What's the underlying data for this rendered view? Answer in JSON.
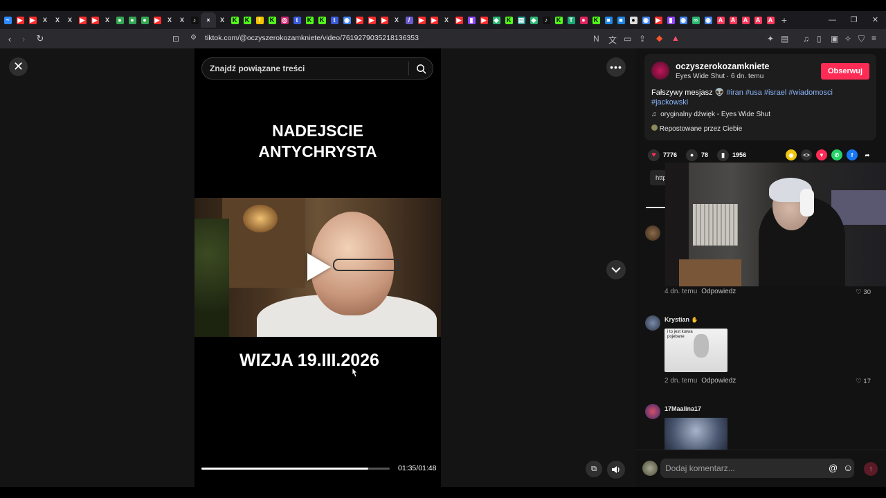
{
  "browser": {
    "tabs": [
      {
        "icon": "messenger-icon",
        "color": "#2e89ff",
        "glyph": "~"
      },
      {
        "icon": "youtube-icon",
        "color": "#ff2d2d",
        "glyph": "▶"
      },
      {
        "icon": "youtube-icon",
        "color": "#ff2d2d",
        "glyph": "▶"
      },
      {
        "icon": "x-icon",
        "color": "#2a2a2a",
        "glyph": "X"
      },
      {
        "icon": "x-icon",
        "color": "#2a2a2a",
        "glyph": "X"
      },
      {
        "icon": "x-icon",
        "color": "#2a2a2a",
        "glyph": "X"
      },
      {
        "icon": "youtube-icon",
        "color": "#ff2d2d",
        "glyph": "▶"
      },
      {
        "icon": "youtube-icon",
        "color": "#ff2d2d",
        "glyph": "▶"
      },
      {
        "icon": "x-icon",
        "color": "#2a2a2a",
        "glyph": "X"
      },
      {
        "icon": "maps-icon",
        "color": "#34a853",
        "glyph": "●"
      },
      {
        "icon": "maps-icon",
        "color": "#34a853",
        "glyph": "●"
      },
      {
        "icon": "maps-icon",
        "color": "#34a853",
        "glyph": "●"
      },
      {
        "icon": "youtube-icon",
        "color": "#ff2d2d",
        "glyph": "▶"
      },
      {
        "icon": "x-icon",
        "color": "#2a2a2a",
        "glyph": "X"
      },
      {
        "icon": "x-icon",
        "color": "#2a2a2a",
        "glyph": "X"
      },
      {
        "icon": "tiktok-icon",
        "color": "#111",
        "glyph": "♪"
      },
      {
        "icon": "close-tab-icon",
        "color": "#2d2d33",
        "glyph": "×"
      },
      {
        "icon": "x-icon",
        "color": "#2a2a2a",
        "glyph": "X"
      },
      {
        "icon": "kick-icon",
        "color": "#53fc18",
        "glyph": "K"
      },
      {
        "icon": "kick-icon",
        "color": "#53fc18",
        "glyph": "K"
      },
      {
        "icon": "yellow-icon",
        "color": "#f5c400",
        "glyph": "!"
      },
      {
        "icon": "kick-icon",
        "color": "#53fc18",
        "glyph": "K"
      },
      {
        "icon": "instagram-icon",
        "color": "#d62976",
        "glyph": "◎"
      },
      {
        "icon": "tip-icon",
        "color": "#3b5bdb",
        "glyph": "t"
      },
      {
        "icon": "kick-icon",
        "color": "#53fc18",
        "glyph": "K"
      },
      {
        "icon": "kick-icon",
        "color": "#53fc18",
        "glyph": "K"
      },
      {
        "icon": "tip-icon",
        "color": "#3b5bdb",
        "glyph": "t"
      },
      {
        "icon": "chrome-icon",
        "color": "#4285f4",
        "glyph": "◉"
      },
      {
        "icon": "youtube-icon",
        "color": "#ff2d2d",
        "glyph": "▶"
      },
      {
        "icon": "youtube-icon",
        "color": "#ff2d2d",
        "glyph": "▶"
      },
      {
        "icon": "youtube-icon",
        "color": "#ff2d2d",
        "glyph": "▶"
      },
      {
        "icon": "x-icon",
        "color": "#2a2a2a",
        "glyph": "X"
      },
      {
        "icon": "feather-icon",
        "color": "#6a5acd",
        "glyph": "/"
      },
      {
        "icon": "youtube-icon",
        "color": "#ff2d2d",
        "glyph": "▶"
      },
      {
        "icon": "youtube-icon",
        "color": "#ff2d2d",
        "glyph": "▶"
      },
      {
        "icon": "x-icon",
        "color": "#2a2a2a",
        "glyph": "X"
      },
      {
        "icon": "youtube-icon",
        "color": "#ff2d2d",
        "glyph": "▶"
      },
      {
        "icon": "twitch-icon",
        "color": "#9146ff",
        "glyph": "▮"
      },
      {
        "icon": "youtube-icon",
        "color": "#ff2d2d",
        "glyph": "▶"
      },
      {
        "icon": "green-icon",
        "color": "#2bb673",
        "glyph": "◆"
      },
      {
        "icon": "kick-icon",
        "color": "#53fc18",
        "glyph": "K"
      },
      {
        "icon": "stat-icon",
        "color": "#2aa198",
        "glyph": "▤"
      },
      {
        "icon": "green-icon",
        "color": "#2bb673",
        "glyph": "◆"
      },
      {
        "icon": "tiktok-icon",
        "color": "#111",
        "glyph": "♪"
      },
      {
        "icon": "kick-icon",
        "color": "#53fc18",
        "glyph": "K"
      },
      {
        "icon": "tt-icon",
        "color": "#19a974",
        "glyph": "T"
      },
      {
        "icon": "record-icon",
        "color": "#e0245e",
        "glyph": "●"
      },
      {
        "icon": "kick-icon",
        "color": "#53fc18",
        "glyph": "K"
      },
      {
        "icon": "blue-icon",
        "color": "#1e88e5",
        "glyph": "■"
      },
      {
        "icon": "blue-icon",
        "color": "#1e88e5",
        "glyph": "■"
      },
      {
        "icon": "github-icon",
        "color": "#ddd",
        "glyph": "●"
      },
      {
        "icon": "chrome-icon",
        "color": "#4285f4",
        "glyph": "◉"
      },
      {
        "icon": "youtube-icon",
        "color": "#ff2d2d",
        "glyph": "▶"
      },
      {
        "icon": "twitch-icon",
        "color": "#9146ff",
        "glyph": "▮"
      },
      {
        "icon": "chrome-icon",
        "color": "#4285f4",
        "glyph": "◉"
      },
      {
        "icon": "link-icon",
        "color": "#2bb673",
        "glyph": "∞"
      },
      {
        "icon": "chrome-icon",
        "color": "#4285f4",
        "glyph": "◉"
      },
      {
        "icon": "airbnb-icon",
        "color": "#ff385c",
        "glyph": "A"
      },
      {
        "icon": "airbnb-icon",
        "color": "#ff385c",
        "glyph": "A"
      },
      {
        "icon": "airbnb-icon",
        "color": "#ff385c",
        "glyph": "A"
      },
      {
        "icon": "airbnb-icon",
        "color": "#ff385c",
        "glyph": "A"
      },
      {
        "icon": "airbnb-icon",
        "color": "#ff385c",
        "glyph": "A"
      }
    ],
    "url": "tiktok.com/@oczyszerokozamkniete/video/7619279035218136353"
  },
  "player": {
    "search_placeholder": "Znajdź powiązane treści",
    "caption_top": "NADEJSCIE\nANTYCHRYSTA",
    "caption_bottom": "WIZJA 19.III.2026",
    "time": "01:35/01:48",
    "progress": 0.885
  },
  "post": {
    "username": "oczyszerokozamkniete",
    "subtitle": "Eyes Wide Shut · 6 dn. temu",
    "follow_label": "Obserwuj",
    "desc_text": "Fałszywy mesjasz",
    "tags": [
      "#iran",
      "#usa",
      "#israel",
      "#wiadomosci",
      "#jackowski"
    ],
    "sound": "oryginalny dźwięk - Eyes Wide Shut",
    "repost": "Repostowane przez Ciebie",
    "likes": "7776",
    "comments": "78",
    "saves": "1956",
    "link_text": "http"
  },
  "comments": [
    {
      "name": "",
      "time": "4 dn. temu",
      "reply": "Odpowiedz",
      "likes": "30"
    },
    {
      "name": "Krystian",
      "time": "2 dn. temu",
      "reply": "Odpowiedz",
      "likes": "17",
      "meme_text": "i to jest kurwa pojebane"
    },
    {
      "name": "17Maalina17"
    }
  ],
  "composer": {
    "placeholder": "Dodaj komentarz..."
  },
  "colors": {
    "accent": "#fe2c55",
    "tag": "#8ab4f8",
    "background": "#121212"
  }
}
